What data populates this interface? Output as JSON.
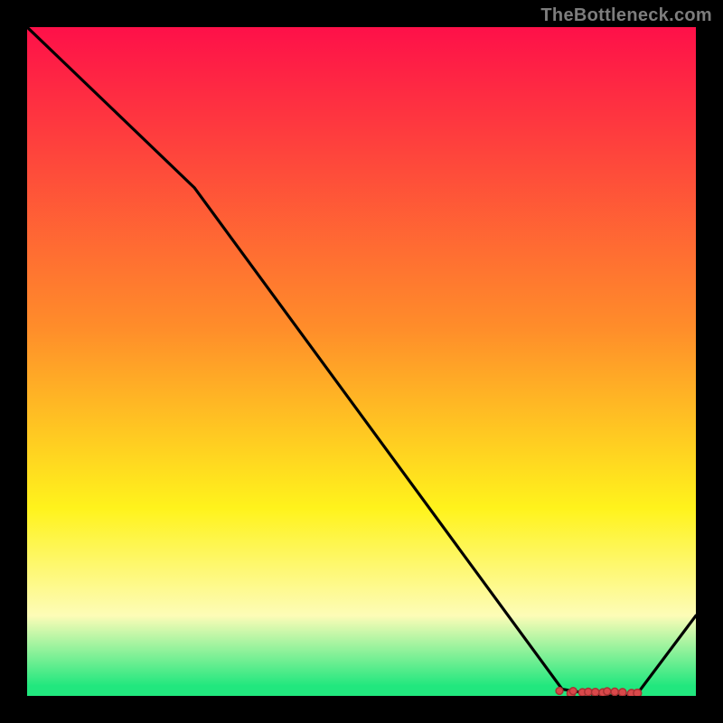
{
  "watermark": "TheBottleneck.com",
  "colors": {
    "background": "#000000",
    "watermark": "#7d7d7d",
    "line": "#000000",
    "marker_fill": "#d9484a",
    "marker_stroke": "#a83234",
    "gradient_top": "#fe1049",
    "gradient_mid1": "#ff8d2a",
    "gradient_mid2": "#fff31c",
    "gradient_pale": "#fdfcb7",
    "gradient_bottom": "#21e77e"
  },
  "chart_data": {
    "type": "line",
    "title": "",
    "xlabel": "",
    "ylabel": "",
    "xlim": [
      0,
      100
    ],
    "ylim": [
      0,
      100
    ],
    "x": [
      0,
      25,
      80,
      86,
      91,
      100
    ],
    "values": [
      100,
      76,
      1,
      0,
      0,
      12
    ],
    "markers": {
      "x_range": [
        80,
        91
      ],
      "y": 0,
      "description": "cluster of small red/salmon dots along the valley bottom near the right side"
    },
    "gradient_stops": [
      {
        "offset": 0.0,
        "color": "#fe1049"
      },
      {
        "offset": 0.45,
        "color": "#ff8d2a"
      },
      {
        "offset": 0.72,
        "color": "#fff31c"
      },
      {
        "offset": 0.88,
        "color": "#fdfcb7"
      },
      {
        "offset": 0.985,
        "color": "#21e77e"
      }
    ]
  }
}
